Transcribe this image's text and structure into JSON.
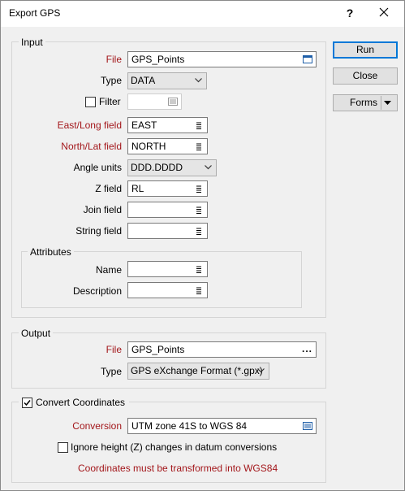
{
  "window": {
    "title": "Export GPS",
    "help_label": "?"
  },
  "buttons": {
    "run": "Run",
    "close": "Close",
    "forms": "Forms"
  },
  "input": {
    "group_title": "Input",
    "file_label": "File",
    "file_value": "GPS_Points",
    "type_label": "Type",
    "type_value": "DATA",
    "filter_label": "Filter",
    "filter_checked": false,
    "filter_value": "",
    "east_label": "East/Long field",
    "east_value": "EAST",
    "north_label": "North/Lat field",
    "north_value": "NORTH",
    "angle_label": "Angle units",
    "angle_value": "DDD.DDDD",
    "z_label": "Z field",
    "z_value": "RL",
    "join_label": "Join field",
    "join_value": "",
    "string_label": "String field",
    "string_value": "",
    "attributes": {
      "group_title": "Attributes",
      "name_label": "Name",
      "name_value": "",
      "description_label": "Description",
      "description_value": ""
    }
  },
  "output": {
    "group_title": "Output",
    "file_label": "File",
    "file_value": "GPS_Points",
    "file_browse": "...",
    "type_label": "Type",
    "type_value": "GPS eXchange Format (*.gpx)"
  },
  "convert": {
    "group_title": "Convert Coordinates",
    "checked": true,
    "conversion_label": "Conversion",
    "conversion_value": "UTM zone 41S  to  WGS 84",
    "ignore_height_label": "Ignore height (Z) changes in datum conversions",
    "ignore_height_checked": false,
    "note": "Coordinates must be transformed into WGS84"
  },
  "colors": {
    "required_label": "#a3171b",
    "default_button_border": "#0078d7",
    "dialog_background": "#f0f0f0"
  }
}
